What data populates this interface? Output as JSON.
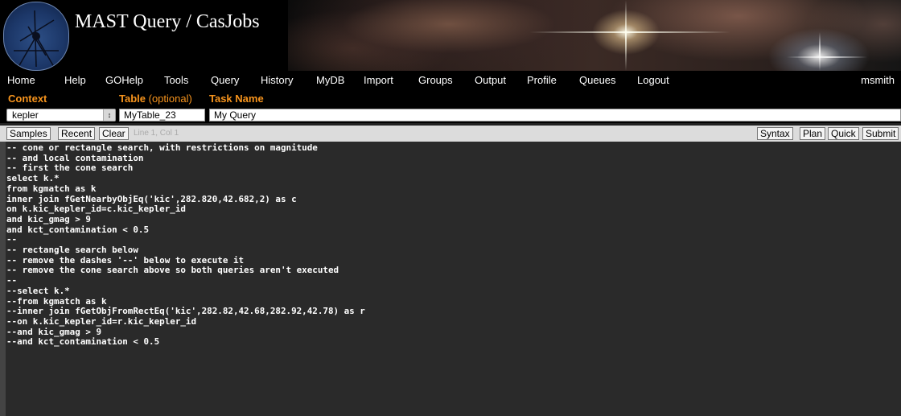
{
  "header": {
    "title": "MAST Query / CasJobs"
  },
  "nav": {
    "items": [
      "Home",
      "Help",
      "GOHelp",
      "Tools",
      "Query",
      "History",
      "MyDB",
      "Import",
      "Groups",
      "Output",
      "Profile",
      "Queues",
      "Logout"
    ],
    "user": "msmith"
  },
  "context": {
    "context_label": "Context",
    "table_label": "Table",
    "table_optional": "(optional)",
    "task_label": "Task Name",
    "context_value": "kepler",
    "table_value": "MyTable_23",
    "task_value": "My Query"
  },
  "toolbar": {
    "samples": "Samples",
    "recent": "Recent",
    "clear": "Clear",
    "status": "Line 1, Col 1",
    "syntax": "Syntax",
    "plan": "Plan",
    "quick": "Quick",
    "submit": "Submit"
  },
  "editor": {
    "lines": [
      "-- cone or rectangle search, with restrictions on magnitude",
      "-- and local contamination",
      "-- first the cone search",
      "select k.*",
      "from kgmatch as k",
      "inner join fGetNearbyObjEq('kic',282.820,42.682,2) as c",
      "on k.kic_kepler_id=c.kic_kepler_id",
      "and kic_gmag > 9",
      "and kct_contamination < 0.5",
      "--",
      "-- rectangle search below",
      "-- remove the dashes '--' below to execute it",
      "-- remove the cone search above so both queries aren't executed",
      "--",
      "--select k.*",
      "--from kgmatch as k",
      "--inner join fGetObjFromRectEq('kic',282.82,42.68,282.92,42.78) as r",
      "--on k.kic_kepler_id=r.kic_kepler_id",
      "--and kic_gmag > 9",
      "--and kct_contamination < 0.5"
    ]
  },
  "colors": {
    "accent": "#f7941d",
    "nav_bg": "#000000",
    "editor_bg": "#2a2a2a"
  }
}
